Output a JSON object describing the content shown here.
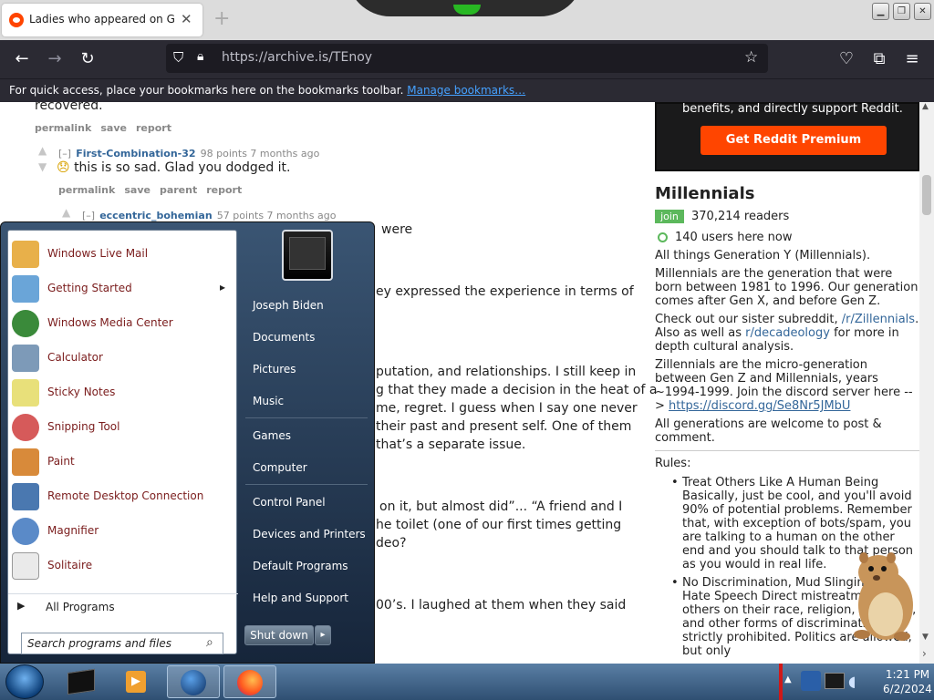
{
  "browser": {
    "tab_title": "Ladies who appeared on Girls Gone Wild",
    "tab_close": "✕",
    "new_tab": "+",
    "url_host": "https://archive.is/",
    "url_path": "TEnoy",
    "bookmarks_text": "For quick access, place your bookmarks here on the bookmarks toolbar.",
    "bookmarks_link": "Manage bookmarks…",
    "window_controls": [
      "minimize",
      "maximize",
      "close"
    ]
  },
  "comments": {
    "top_fragment": "recovered.",
    "top_links": [
      "permalink",
      "save",
      "report"
    ],
    "c1": {
      "toggle": "[–]",
      "author": "First-Combination-32",
      "meta": "98 points 7 months ago",
      "text": "this is so sad. Glad you dodged it.",
      "links": [
        "permalink",
        "save",
        "parent",
        "report"
      ]
    },
    "c2": {
      "toggle": "[–]",
      "author": "eccentric_bohemian",
      "meta": "57 points 7 months ago"
    },
    "fragments": [
      "were",
      "ey expressed the experience in terms of",
      "putation, and relationships. I still keep in",
      "g that they made a decision in the heat of a",
      "me, regret. I guess when I say one never",
      "their past and present self. One of them",
      "that’s a separate issue.",
      "on it, but almost did”... “A friend and I",
      "he toilet (one of our first times getting",
      "deo?",
      "00’s. I laughed at them when they said"
    ]
  },
  "sidebar": {
    "premium_text": "benefits, and directly support Reddit.",
    "premium_button": "Get Reddit Premium",
    "title": "Millennials",
    "join": "join",
    "readers": "370,214 readers",
    "online": "140 users here now",
    "p1": "All things Generation Y (Millennials).",
    "p2": "Millennials are the generation that were born between 1981 to 1996. Our generation comes after Gen X, and before Gen Z.",
    "p3a": "Check out our sister subreddit,",
    "p3link1": "/r/Zillennials",
    "p3b": ". Also as well as",
    "p3link2": "r/decadeology",
    "p3c": "for more in depth cultural analysis.",
    "p4a": "Zillennials are the micro-generation between Gen Z and Millennials, years ~1994-1999. Join the discord server here -->",
    "p4link": "https://discord.gg/Se8Nr5JMbU",
    "p5": "All generations are welcome to post & comment.",
    "rules_title": "Rules:",
    "rule1": "Treat Others Like A Human Being Basically, just be cool, and you'll avoid 90% of potential problems. Remember that, with exception of bots/spam, you are talking to a human on the other end and you should talk to that person as you would in real life.",
    "rule2": "No Discrimination, Mud Slinging, or Hate Speech Direct mistreatment of others on their race, religion, sexuality, and other forms of discrimination are strictly prohibited. Politics are allowed, but only"
  },
  "startmenu": {
    "programs": [
      {
        "label": "Windows Live Mail",
        "icon": "mail-icon",
        "color": "#e8b04a"
      },
      {
        "label": "Getting Started",
        "icon": "getting-started-icon",
        "color": "#6aa5d8",
        "arrow": "▸"
      },
      {
        "label": "Windows Media Center",
        "icon": "media-center-icon",
        "color": "#3a8a3a"
      },
      {
        "label": "Calculator",
        "icon": "calculator-icon",
        "color": "#7d9ab8"
      },
      {
        "label": "Sticky Notes",
        "icon": "sticky-notes-icon",
        "color": "#e8e07a"
      },
      {
        "label": "Snipping Tool",
        "icon": "snipping-tool-icon",
        "color": "#d65a5a"
      },
      {
        "label": "Paint",
        "icon": "paint-icon",
        "color": "#d88a3a"
      },
      {
        "label": "Remote Desktop Connection",
        "icon": "remote-desktop-icon",
        "color": "#4a78b0"
      },
      {
        "label": "Magnifier",
        "icon": "magnifier-icon",
        "color": "#5a8ac8"
      },
      {
        "label": "Solitaire",
        "icon": "solitaire-icon",
        "color": "#eaeaea"
      }
    ],
    "all_programs": "All Programs",
    "search_placeholder": "Search programs and files",
    "right_items": [
      "Joseph Biden",
      "Documents",
      "Pictures",
      "Music",
      "Games",
      "Computer",
      "Control Panel",
      "Devices and Printers",
      "Default Programs",
      "Help and Support"
    ],
    "shutdown": "Shut down"
  },
  "taskbar": {
    "time": "1:21 PM",
    "date": "6/2/2024",
    "items": [
      "command-prompt-icon",
      "media-player-icon",
      "globe-icon",
      "firefox-icon"
    ]
  }
}
